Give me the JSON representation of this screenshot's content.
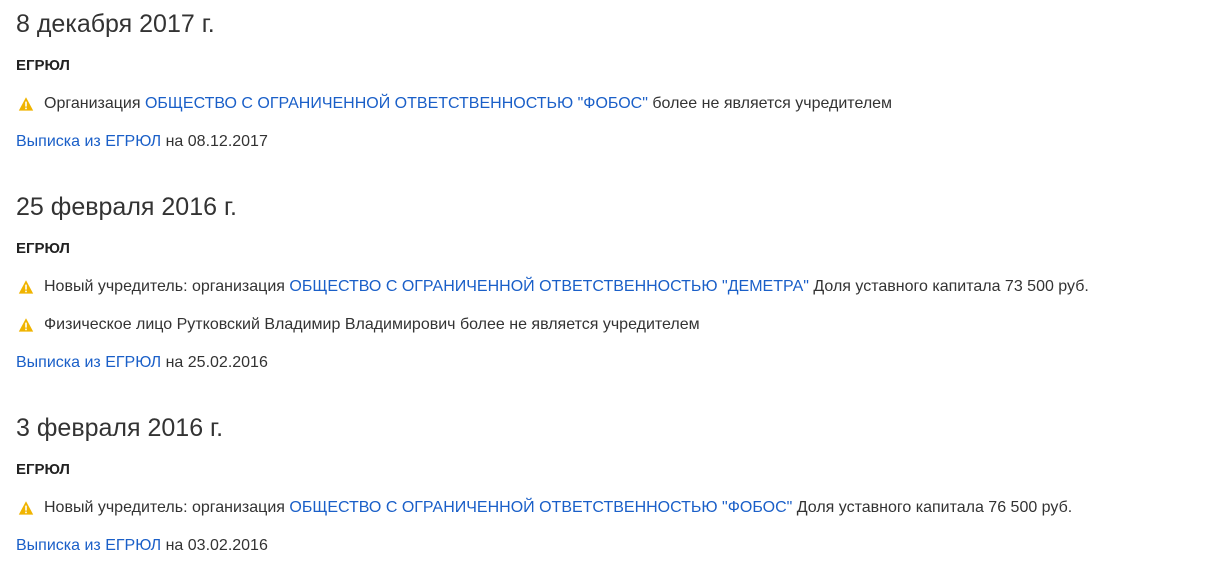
{
  "colors": {
    "link": "#1a5fc8",
    "warning": "#f0b400",
    "text": "#333333"
  },
  "sections": [
    {
      "date": "8 декабря 2017 г.",
      "source": "ЕГРЮЛ",
      "events": [
        {
          "icon": "warning-icon",
          "prefix": "Организация",
          "link": "ОБЩЕСТВО С ОГРАНИЧЕННОЙ ОТВЕТСТВЕННОСТЬЮ \"ФОБОС\"",
          "suffix": "более не является учредителем"
        }
      ],
      "extract_link": "Выписка из ЕГРЮЛ",
      "extract_date": "на 08.12.2017"
    },
    {
      "date": "25 февраля 2016 г.",
      "source": "ЕГРЮЛ",
      "events": [
        {
          "icon": "warning-icon",
          "prefix": "Новый учредитель: организация",
          "link": "ОБЩЕСТВО С ОГРАНИЧЕННОЙ ОТВЕТСТВЕННОСТЬЮ \"ДЕМЕТРА\"",
          "suffix": "Доля уставного капитала 73 500 руб."
        },
        {
          "icon": "warning-icon",
          "text": "Физическое лицо Рутковский Владимир Владимирович более не является учредителем"
        }
      ],
      "extract_link": "Выписка из ЕГРЮЛ",
      "extract_date": "на 25.02.2016"
    },
    {
      "date": "3 февраля 2016 г.",
      "source": "ЕГРЮЛ",
      "events": [
        {
          "icon": "warning-icon",
          "prefix": "Новый учредитель: организация",
          "link": "ОБЩЕСТВО С ОГРАНИЧЕННОЙ ОТВЕТСТВЕННОСТЬЮ \"ФОБОС\"",
          "suffix": "Доля уставного капитала 76 500 руб."
        }
      ],
      "extract_link": "Выписка из ЕГРЮЛ",
      "extract_date": "на 03.02.2016"
    }
  ]
}
